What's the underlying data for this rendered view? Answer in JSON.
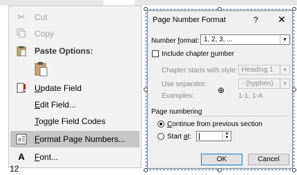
{
  "context_menu": {
    "items": [
      {
        "label": "Cut",
        "icon": "scissors-icon",
        "glyph": "✂",
        "disabled": true
      },
      {
        "label": "Copy",
        "icon": "copy-icon",
        "glyph": "❐",
        "disabled": true
      },
      {
        "label": "Paste Options:",
        "icon": "clipboard-icon",
        "glyph": "📋"
      },
      {
        "label": "Update Field",
        "icon": "update-field-icon",
        "glyph": "!"
      },
      {
        "label": "Edit Field...",
        "icon": "",
        "glyph": ""
      },
      {
        "label": "Toggle Field Codes",
        "icon": "",
        "glyph": ""
      },
      {
        "label": "Format Page Numbers...",
        "icon": "format-page-numbers-icon",
        "glyph": "#"
      },
      {
        "label": "Font...",
        "icon": "font-icon",
        "glyph": "A"
      }
    ],
    "bottom_text": "12"
  },
  "dialog": {
    "title": "Page Number Format",
    "help": "?",
    "close": "✕",
    "number_format_label": "Number format:",
    "number_format_value": "1, 2, 3, ...",
    "include_chapter_label": "Include chapter number",
    "chapter_style_label": "Chapter starts with style:",
    "chapter_style_value": "Heading 1",
    "separator_label": "Use separator:",
    "separator_value": "-   (hyphen)",
    "examples_label": "Examples:",
    "examples_value": "1-1, 1-A",
    "page_numbering_label": "Page numbering",
    "continue_label": "Continue from previous section",
    "start_at_label": "Start at:",
    "start_at_value": "",
    "ok_label": "OK",
    "cancel_label": "Cancel"
  },
  "colors": {
    "accent": "#0078d7",
    "menu_bg": "#f2f2f2",
    "highlight": "#c6c6c6",
    "dialog_bg": "#f0f0f0"
  }
}
